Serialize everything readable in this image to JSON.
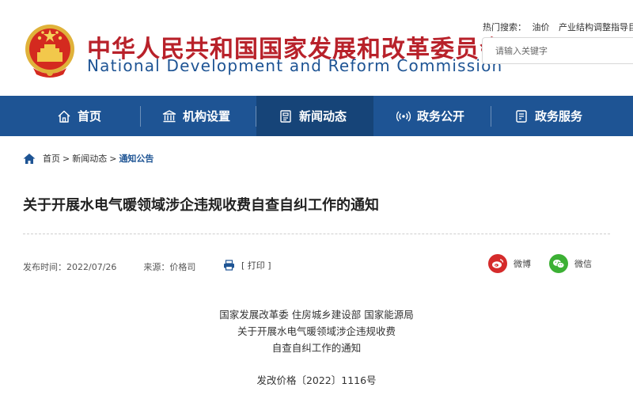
{
  "header": {
    "title_cn": "中华人民共和国国家发展和改革委员会",
    "title_en": "National Development and Reform Commission",
    "hot_search_label": "热门搜索：",
    "hot_search_terms": [
      "油价",
      "产业结构调整指导目录"
    ],
    "search_placeholder": "请输入关键字"
  },
  "nav": {
    "items": [
      {
        "label": "首页",
        "icon": "home-outline-icon"
      },
      {
        "label": "机构设置",
        "icon": "building-icon"
      },
      {
        "label": "新闻动态",
        "icon": "news-icon"
      },
      {
        "label": "政务公开",
        "icon": "broadcast-icon"
      },
      {
        "label": "政务服务",
        "icon": "service-icon"
      }
    ],
    "active_index": 2
  },
  "breadcrumb": {
    "home": "首页",
    "level1": "新闻动态",
    "current": "通知公告",
    "separator": ">"
  },
  "article": {
    "title": "关于开展水电气暖领域涉企违规收费自查自纠工作的通知",
    "publish_label": "发布时间：",
    "publish_date": "2022/07/26",
    "source_label": "来源：",
    "source": "价格司",
    "print_label": "[ 打印 ]",
    "share_weibo": "微博",
    "share_wechat": "微信",
    "issuers": "国家发展改革委 住房城乡建设部 国家能源局",
    "heading_line1": "关于开展水电气暖领域涉企违规收费",
    "heading_line2": "自查自纠工作的通知",
    "doc_number": "发改价格〔2022〕1116号"
  },
  "colors": {
    "brand_red": "#b8212a",
    "brand_blue": "#1e5494",
    "nav_active": "#164478",
    "weibo_red": "#d52b2b",
    "wechat_green": "#3cb034"
  }
}
